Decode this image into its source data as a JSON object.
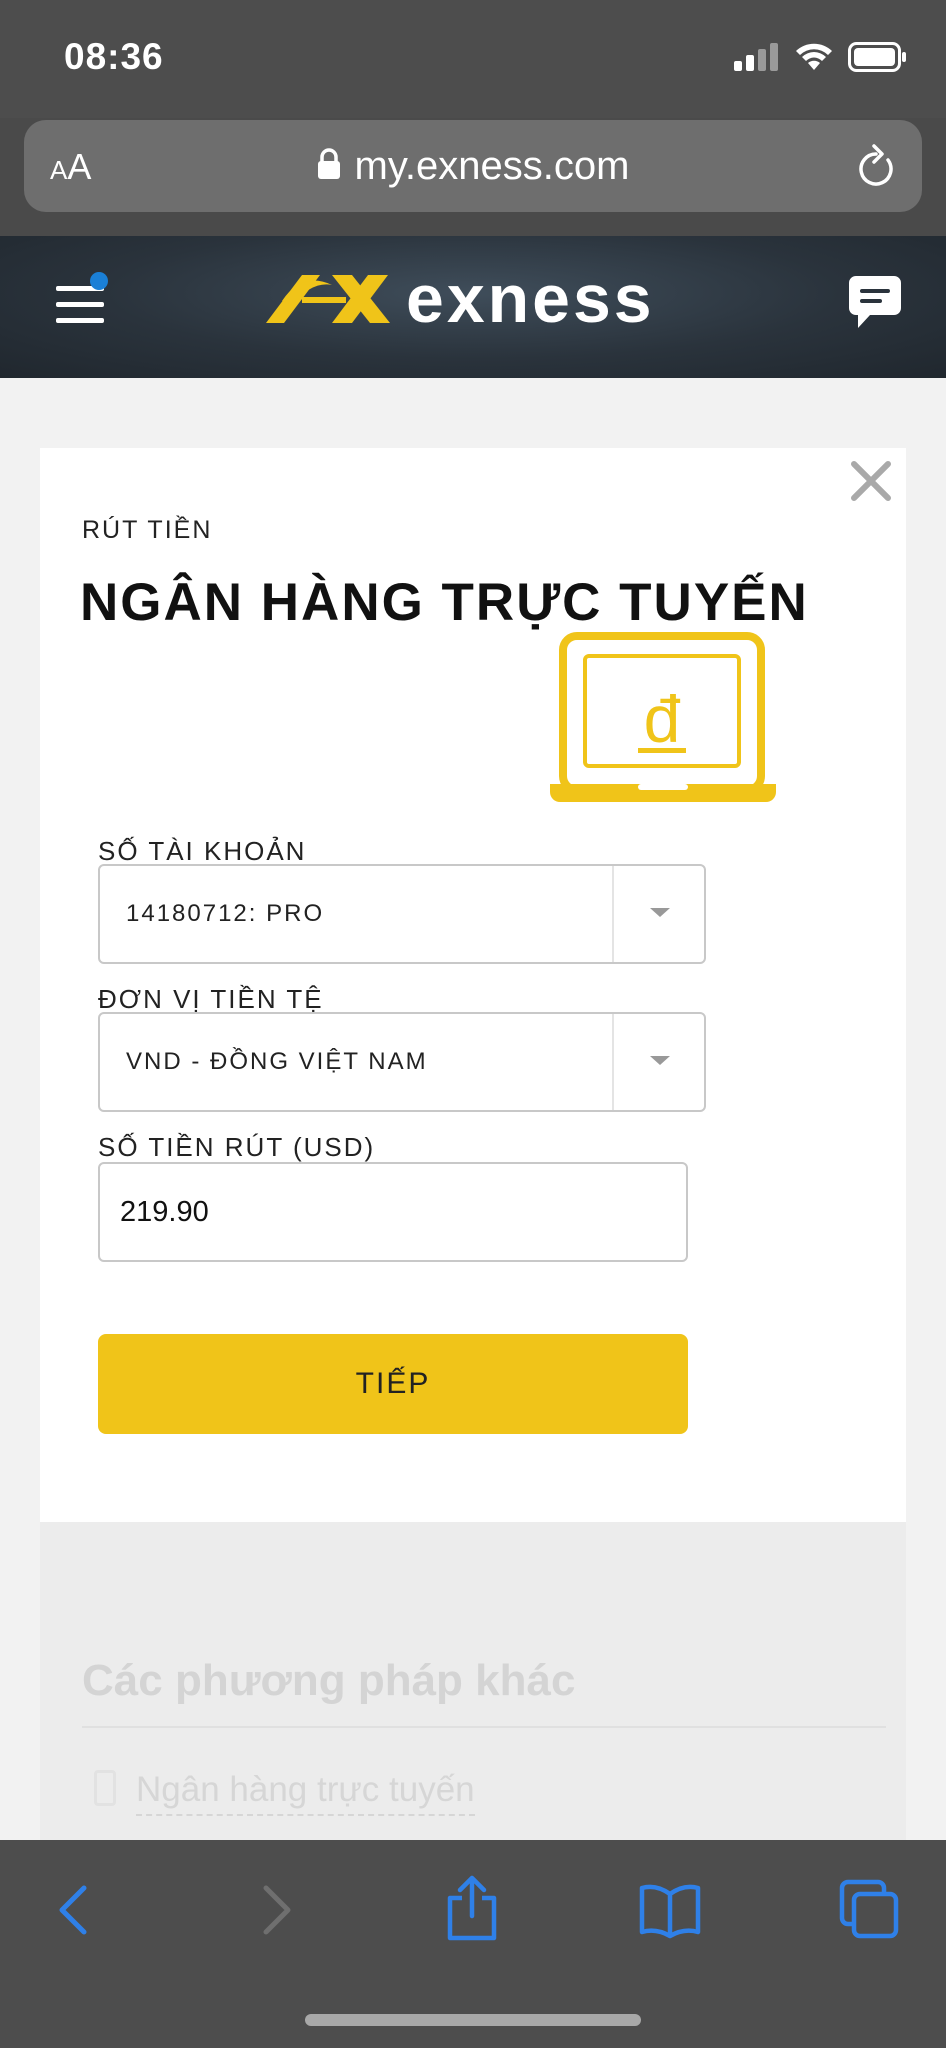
{
  "status_bar": {
    "time": "08:36"
  },
  "browser": {
    "aa_small": "A",
    "aa_large": "A",
    "url": "my.exness.com"
  },
  "header": {
    "logo_text": "exness"
  },
  "modal": {
    "eyebrow": "RÚT TIỀN",
    "title": "NGÂN HÀNG TRỰC TUYẾN",
    "laptop_symbol": "đ",
    "account_label": "SỐ TÀI KHOẢN",
    "account_value": "14180712: PRO",
    "currency_label": "ĐƠN VỊ TIỀN TỆ",
    "currency_value": "VND - ĐỒNG VIỆT NAM",
    "amount_label": "SỐ TIỀN RÚT (USD)",
    "amount_value": "219.90",
    "next_button": "TIẾP"
  },
  "background_page": {
    "other_methods_title": "Các phương pháp khác",
    "other_method_link": "Ngân hàng trực tuyến"
  },
  "colors": {
    "brand_yellow": "#f0c419",
    "header_dark": "#2a333c",
    "ios_blue": "#2f80e8",
    "notification_dot": "#1a7fd6"
  }
}
